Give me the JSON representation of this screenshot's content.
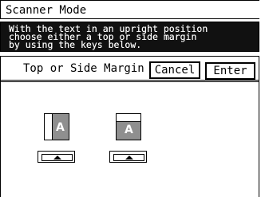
{
  "title": "Scanner Mode",
  "instruction_lines": [
    "With the text in an upright position",
    "choose either a top or side margin",
    "by using the keys below."
  ],
  "panel": {
    "label": "Top or Side Margin",
    "cancel_label": "Cancel",
    "enter_label": "Enter"
  },
  "options": [
    {
      "name": "top-margin",
      "letter": "A"
    },
    {
      "name": "side-margin",
      "letter": "A"
    }
  ]
}
